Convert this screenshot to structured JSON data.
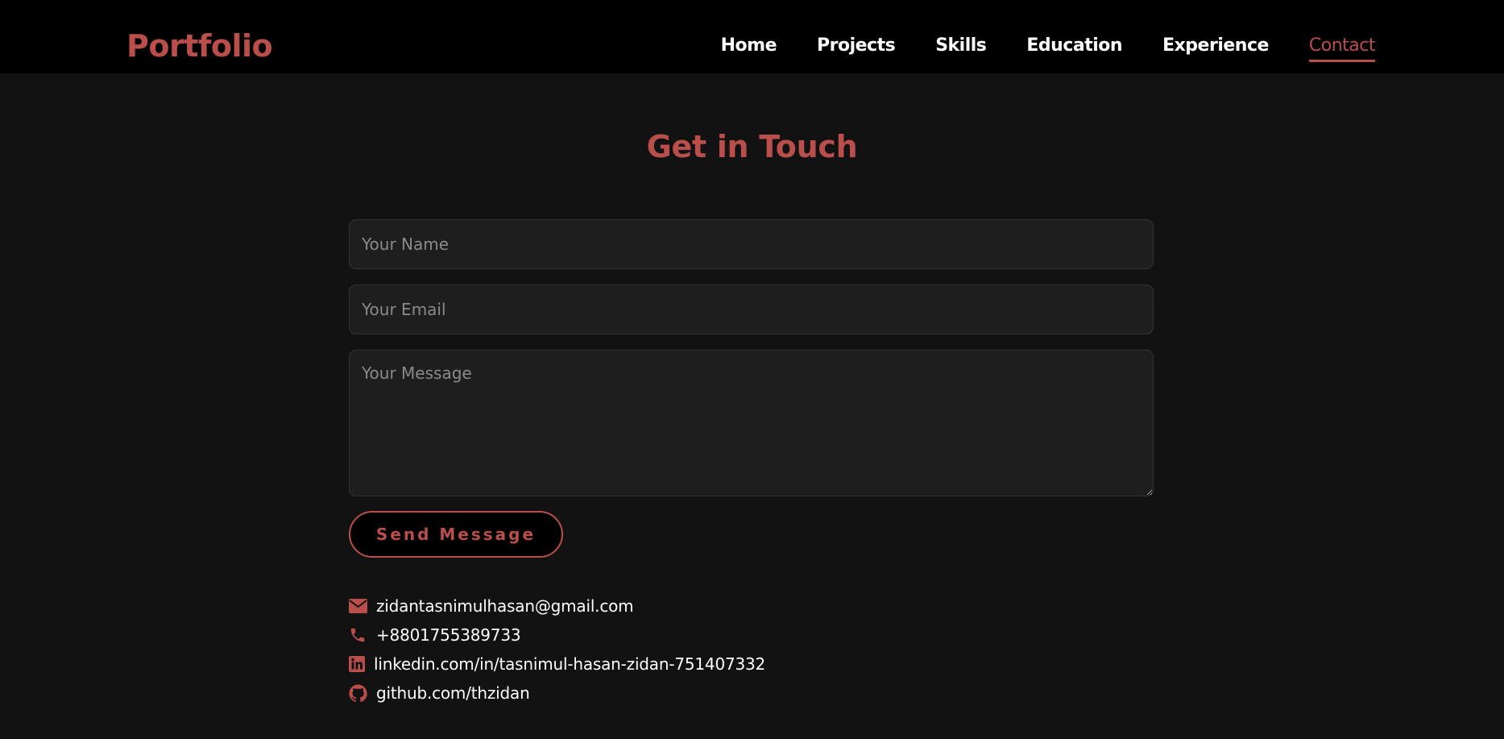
{
  "brand": {
    "logo_text": "Portfolio",
    "accent_color": "#b94e4a"
  },
  "nav": {
    "items": [
      {
        "label": "Home",
        "active": false
      },
      {
        "label": "Projects",
        "active": false
      },
      {
        "label": "Skills",
        "active": false
      },
      {
        "label": "Education",
        "active": false
      },
      {
        "label": "Experience",
        "active": false
      },
      {
        "label": "Contact",
        "active": true
      }
    ]
  },
  "contact": {
    "title": "Get in Touch",
    "form": {
      "name_placeholder": "Your Name",
      "name_value": "",
      "email_placeholder": "Your Email",
      "email_value": "",
      "message_placeholder": "Your Message",
      "message_value": "",
      "submit_label": "Send Message"
    },
    "info": [
      {
        "icon": "envelope-icon",
        "text": "zidantasnimulhasan@gmail.com"
      },
      {
        "icon": "phone-icon",
        "text": "+8801755389733"
      },
      {
        "icon": "linkedin-icon",
        "text": "linkedin.com/in/tasnimul-hasan-zidan-751407332"
      },
      {
        "icon": "github-icon",
        "text": "github.com/thzidan"
      }
    ]
  }
}
